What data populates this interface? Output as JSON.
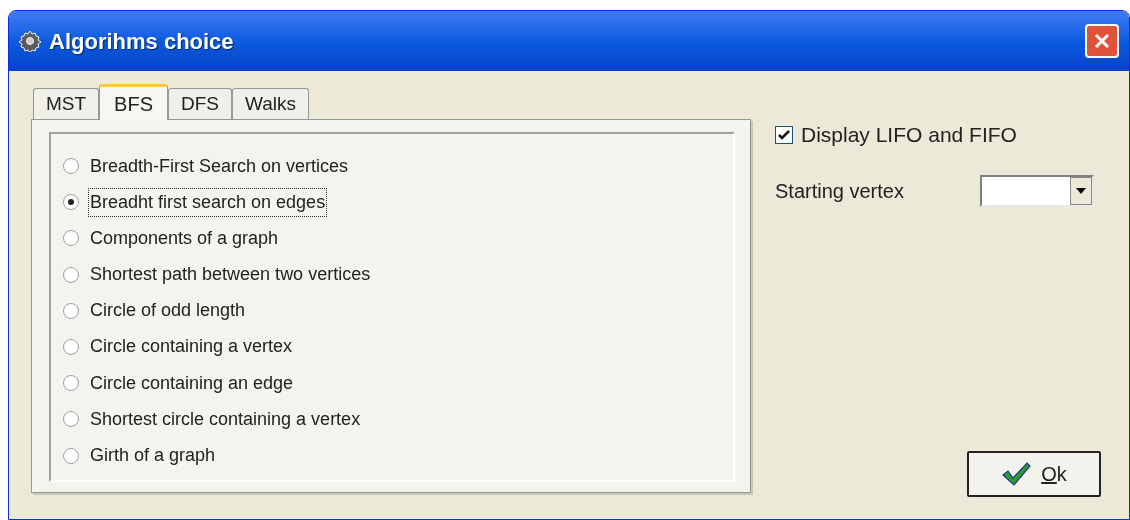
{
  "window": {
    "title": "Algorihms choice"
  },
  "tabs": [
    {
      "label": "MST",
      "selected": false
    },
    {
      "label": "BFS",
      "selected": true
    },
    {
      "label": "DFS",
      "selected": false
    },
    {
      "label": "Walks",
      "selected": false
    }
  ],
  "options": [
    {
      "label": "Breadth-First Search on vertices",
      "selected": false
    },
    {
      "label": "Breadht first search on edges",
      "selected": true
    },
    {
      "label": "Components of a graph",
      "selected": false
    },
    {
      "label": "Shortest path between two vertices",
      "selected": false
    },
    {
      "label": "Circle of odd length",
      "selected": false
    },
    {
      "label": "Circle containing a vertex",
      "selected": false
    },
    {
      "label": "Circle containing an edge",
      "selected": false
    },
    {
      "label": "Shortest circle containing a vertex",
      "selected": false
    },
    {
      "label": "Girth of a graph",
      "selected": false
    }
  ],
  "display_checkbox": {
    "label": "Display LIFO and FIFO",
    "checked": true
  },
  "starting_vertex": {
    "label": "Starting vertex"
  },
  "ok_button": {
    "label": "Ok"
  }
}
